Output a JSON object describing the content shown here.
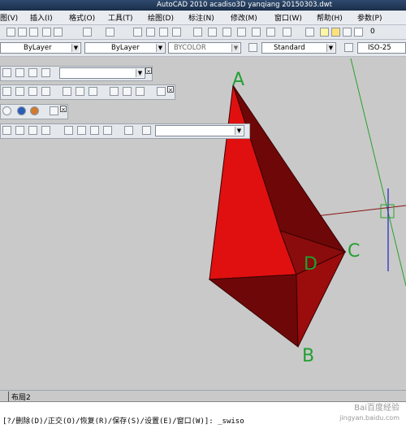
{
  "window": {
    "title": "AutoCAD 2010    acadiso3D  yanqiang 20150303.dwt"
  },
  "menu": {
    "items": [
      "图(V)",
      "插入(I)",
      "格式(O)",
      "工具(T)",
      "绘图(D)",
      "标注(N)",
      "修改(M)",
      "窗口(W)",
      "帮助(H)",
      "参数(P)"
    ]
  },
  "properties": {
    "layer_color": "ByLayer",
    "layer_linetype": "ByLayer",
    "color": "BYCOLOR",
    "text_style": "Standard",
    "dim_style": "ISO-25",
    "layer_value": "0"
  },
  "drawing": {
    "labels": {
      "a": "A",
      "b": "B",
      "c": "C",
      "d": "D"
    },
    "colors": {
      "face_light": "#e01010",
      "face_dark": "#6e0808",
      "face_mid": "#8b0c0c",
      "edge": "#3a0000"
    }
  },
  "tabs": {
    "layout2": "布局2"
  },
  "command_line": {
    "text": "[?/删除(D)/正交(O)/恢复(R)/保存(S)/设置(E)/窗口(W)]: _swiso"
  },
  "watermark": {
    "line1": "Bai百度经验",
    "line2": "jingyan.baidu.com"
  }
}
